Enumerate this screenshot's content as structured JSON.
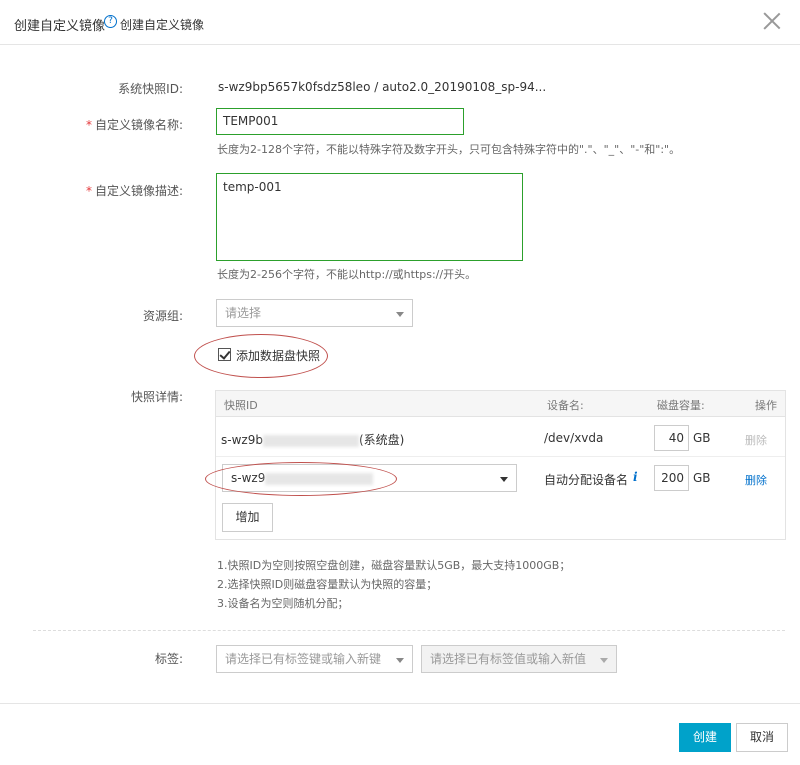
{
  "dialog": {
    "title": "创建自定义镜像",
    "help_icon": "?",
    "help_text": "创建自定义镜像"
  },
  "form": {
    "snapshot_id_label": "系统快照ID:",
    "snapshot_id_value": "s-wz9bp5657k0fsdz58leo /  auto2.0_20190108_sp-94...",
    "name_label": "自定义镜像名称:",
    "name_value": "TEMP001",
    "name_hint": "长度为2-128个字符，不能以特殊字符及数字开头，只可包含特殊字符中的\".\"、\"_\"、\"-\"和\":\"。",
    "desc_label": "自定义镜像描述:",
    "desc_value": "temp-001",
    "desc_hint": "长度为2-256个字符，不能以http://或https://开头。",
    "resource_group_label": "资源组:",
    "resource_group_placeholder": "请选择",
    "add_data_disk_label": "添加数据盘快照",
    "add_data_disk_checked": true,
    "snapshot_detail_label": "快照详情:"
  },
  "table": {
    "headers": {
      "snapshot_id": "快照ID",
      "device": "设备名:",
      "capacity": "磁盘容量:",
      "action": "操作"
    },
    "rows": [
      {
        "id_prefix": "s-wz9b",
        "id_suffix": "(系统盘)",
        "device": "/dev/xvda",
        "capacity": "40",
        "unit": "GB",
        "action": "删除",
        "action_enabled": false
      },
      {
        "id_prefix": "s-wz9",
        "device": "自动分配设备名",
        "info_icon": "i",
        "capacity": "200",
        "unit": "GB",
        "action": "删除",
        "action_enabled": true
      }
    ],
    "add_button": "增加"
  },
  "notes": [
    "1.快照ID为空则按照空盘创建，磁盘容量默认5GB，最大支持1000GB；",
    "2.选择快照ID则磁盘容量默认为快照的容量；",
    "3.设备名为空则随机分配；"
  ],
  "tags": {
    "label": "标签:",
    "key_placeholder": "请选择已有标签键或输入新键",
    "value_placeholder": "请选择已有标签值或输入新值"
  },
  "footer": {
    "create_button": "创建",
    "cancel_button": "取消"
  },
  "colors": {
    "primary": "#00a2ca",
    "link": "#0070cc",
    "required": "#e4393c",
    "valid_border": "#2ca02c",
    "annotation": "#c0504d"
  }
}
